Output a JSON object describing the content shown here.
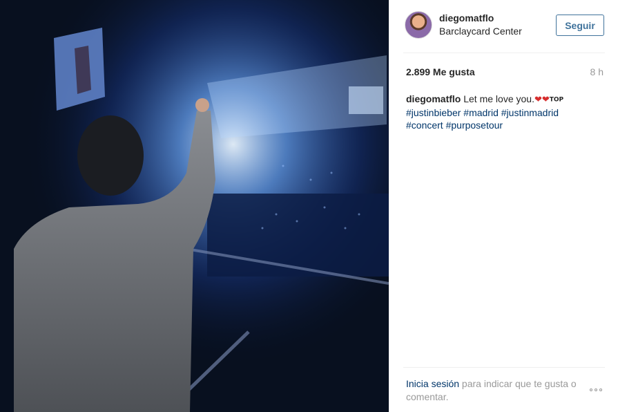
{
  "post": {
    "photo_alt": "",
    "header": {
      "username": "diegomatflo",
      "location": "Barclaycard Center",
      "follow_label": "Seguir"
    },
    "likes": "2.899 Me gusta",
    "time": "8 h",
    "caption": {
      "username": "diegomatflo",
      "text": "Let me love you.",
      "emoji": "❤❤",
      "emoji_top": "TOP",
      "hashtags": [
        "#justinbieber",
        "#madrid",
        "#justinmadrid",
        "#concert",
        "#purposetour"
      ]
    },
    "footer": {
      "login_link": "Inicia sesión",
      "login_text": " para indicar que te gusta o comentar."
    }
  },
  "colors": {
    "link": "#003569",
    "follow": "#3f729b",
    "muted": "#999999"
  },
  "icons": {
    "more": "ellipsis-icon",
    "avatar": "avatar"
  }
}
